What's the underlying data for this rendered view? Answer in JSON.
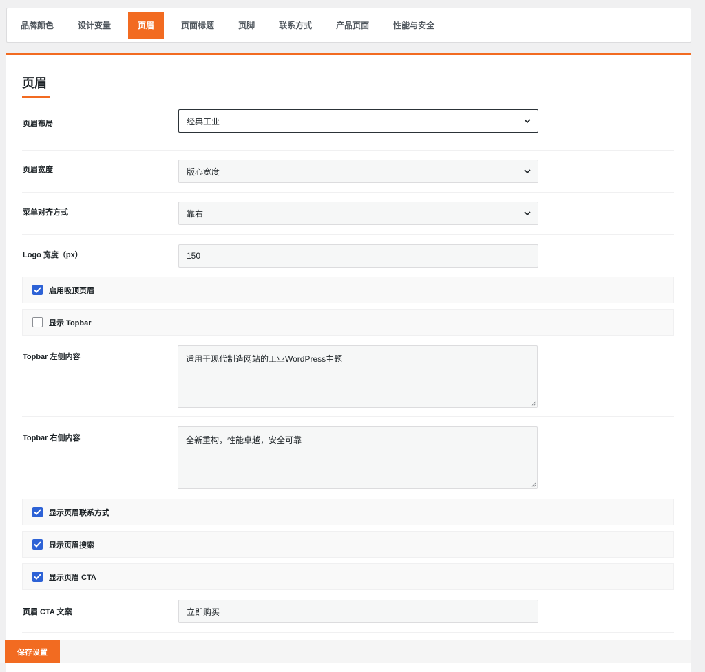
{
  "tabs": [
    {
      "label": "品牌颜色",
      "active": false
    },
    {
      "label": "设计变量",
      "active": false
    },
    {
      "label": "页眉",
      "active": true
    },
    {
      "label": "页面标题",
      "active": false
    },
    {
      "label": "页脚",
      "active": false
    },
    {
      "label": "联系方式",
      "active": false
    },
    {
      "label": "产品页面",
      "active": false
    },
    {
      "label": "性能与安全",
      "active": false
    }
  ],
  "section": {
    "title": "页眉"
  },
  "fields": {
    "header_layout": {
      "label": "页眉布局",
      "value": "经典工业"
    },
    "header_width": {
      "label": "页眉宽度",
      "value": "版心宽度"
    },
    "menu_align": {
      "label": "菜单对齐方式",
      "value": "靠右"
    },
    "logo_width": {
      "label": "Logo 宽度（px）",
      "value": "150"
    },
    "topbar_left": {
      "label": "Topbar 左侧内容",
      "value": "适用于现代制造网站的工业WordPress主题"
    },
    "topbar_right": {
      "label": "Topbar 右侧内容",
      "value": "全新重构，性能卓越，安全可靠"
    },
    "cta_text": {
      "label": "页眉 CTA 文案",
      "value": "立即购买"
    }
  },
  "checkboxes": {
    "sticky_header": {
      "label": "启用吸顶页眉",
      "checked": true
    },
    "show_topbar": {
      "label": "显示 Topbar",
      "checked": false
    },
    "show_contact": {
      "label": "显示页眉联系方式",
      "checked": true
    },
    "show_search": {
      "label": "显示页眉搜索",
      "checked": true
    },
    "show_cta": {
      "label": "显示页眉 CTA",
      "checked": true
    }
  },
  "footer": {
    "save_label": "保存设置"
  },
  "colors": {
    "accent": "#f26b21",
    "checkbox": "#2d62d6"
  },
  "icons": {
    "select": "chevron-down-icon",
    "check": "checkmark-icon"
  }
}
